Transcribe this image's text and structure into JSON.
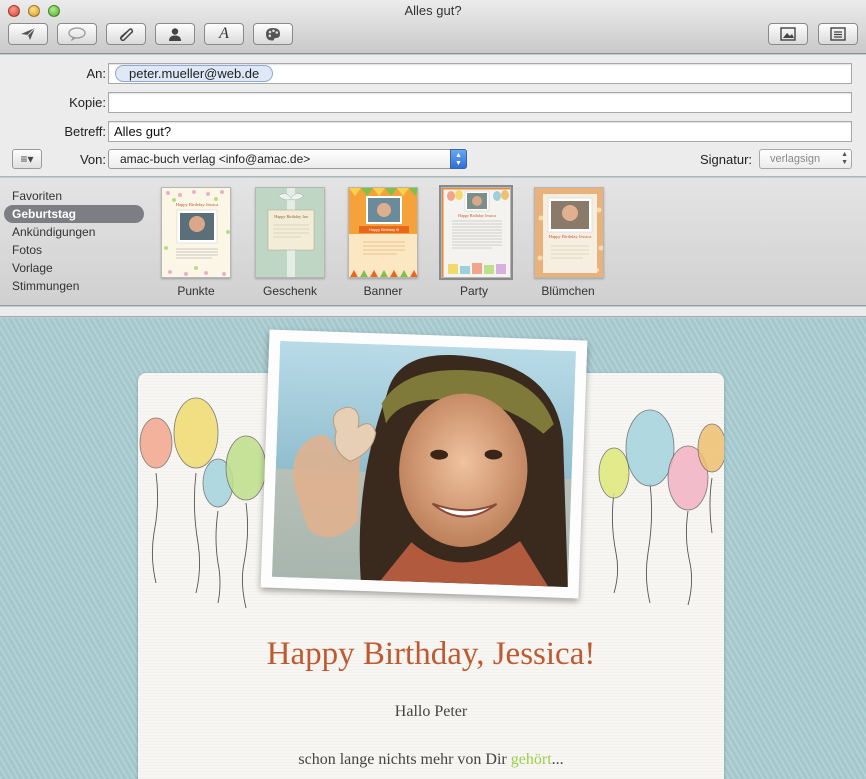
{
  "window": {
    "title": "Alles gut?"
  },
  "toolbar": {
    "buttons": [
      {
        "name": "send",
        "icon": "paper-plane-icon"
      },
      {
        "name": "reply",
        "icon": "speech-bubble-icon"
      },
      {
        "name": "attach",
        "icon": "paperclip-icon"
      },
      {
        "name": "address",
        "icon": "person-icon"
      },
      {
        "name": "fonts",
        "icon": "font-a-icon"
      },
      {
        "name": "colors",
        "icon": "palette-icon"
      },
      {
        "name": "photo-browser",
        "icon": "photo-icon"
      },
      {
        "name": "stationery",
        "icon": "stationery-icon"
      }
    ]
  },
  "header": {
    "to_label": "An:",
    "to_value": "peter.mueller@web.de",
    "cc_label": "Kopie:",
    "cc_value": "",
    "subject_label": "Betreff:",
    "subject_value": "Alles gut?",
    "from_label": "Von:",
    "from_value": "amac-buch verlag <info@amac.de>",
    "signature_label": "Signatur:",
    "signature_value": "verlagsign",
    "list_button": "≡▾"
  },
  "stationery": {
    "categories": [
      {
        "label": "Favoriten",
        "selected": false
      },
      {
        "label": "Geburtstag",
        "selected": true
      },
      {
        "label": "Ankündigungen",
        "selected": false
      },
      {
        "label": "Fotos",
        "selected": false
      },
      {
        "label": "Vorlage",
        "selected": false
      },
      {
        "label": "Stimmungen",
        "selected": false
      }
    ],
    "templates": [
      {
        "label": "Punkte",
        "selected": false
      },
      {
        "label": "Geschenk",
        "selected": false
      },
      {
        "label": "Banner",
        "selected": false
      },
      {
        "label": "Party",
        "selected": true
      },
      {
        "label": "Blümchen",
        "selected": false
      }
    ],
    "mini_texts": {
      "punkte": "Happy Birthday Jessica",
      "geschenk": "Happy Birthday Jan",
      "banner": "Happy Birthday Ill",
      "party": "Happy Birthday Jessica",
      "bluemchen": "Happy Birthday Jessica"
    }
  },
  "message": {
    "headline": "Happy Birthday, Jessica!",
    "greeting": "Hallo Peter",
    "body_prefix": "schon lange nichts mehr von Dir ",
    "body_accent": "gehört",
    "body_suffix": "...",
    "accent_color": "#9bd04a",
    "headline_color": "#c0592f"
  }
}
